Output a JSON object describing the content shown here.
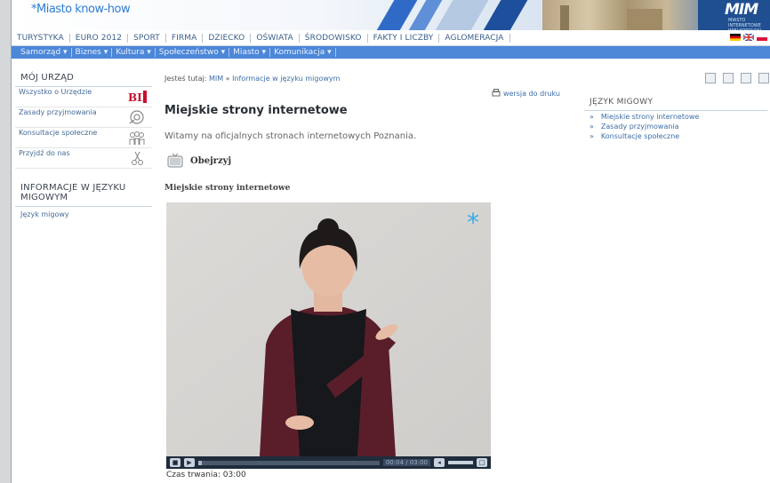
{
  "header": {
    "slogan": "*Miasto know-how",
    "logo_text": "MIM",
    "logo_subtext": "MIASTO INTERNETOWE WIELKOPOLSKI"
  },
  "top_menu": [
    "TURYSTYKA",
    "EURO 2012",
    "SPORT",
    "FIRMA",
    "DZIECKO",
    "OŚWIATA",
    "ŚRODOWISKO",
    "FAKTY I LICZBY",
    "AGLOMERACJA"
  ],
  "blue_menu": [
    "Samorząd ▾",
    "Biznes ▾",
    "Kultura ▾",
    "Społeczeństwo ▾",
    "Miasto ▾",
    "Komunikacja ▾"
  ],
  "left_column": {
    "section1_title": "MÓJ URZĄD",
    "items": [
      {
        "label": "Wszystko o Urzędzie",
        "icon": "bip-logo-icon"
      },
      {
        "label": "Zasady przyjmowania",
        "icon": "at-sign-icon"
      },
      {
        "label": "Konsultacje społeczne",
        "icon": "people-icon"
      },
      {
        "label": "Przyjdź do nas",
        "icon": "scissors-icon"
      }
    ],
    "section2_title": "INFORMACJE W JĘZYKU MIGOWYM",
    "link": "Język migowy"
  },
  "breadcrumb": {
    "prefix": "Jesteś tutaj:",
    "home": "MIM",
    "separator": "»",
    "current": "Informacje w języku migowym"
  },
  "print_label": "wersja do druku",
  "page_title": "Miejskie strony internetowe",
  "welcome": "Witamy na oficjalnych stronach internetowych Poznania.",
  "watch_label": "Obejrzyj",
  "video_subtitle": "Miejskie strony internetowe",
  "player": {
    "time": "00:04 / 03:00",
    "progress": 0.02
  },
  "duration": "Czas trwania: 03:00",
  "right_column": {
    "title": "JĘZYK MIGOWY",
    "items": [
      "Miejskie strony internetowe",
      "Zasady przyjmowania",
      "Konsultacje społeczne"
    ]
  },
  "colors": {
    "accent_blue": "#4c87d8",
    "link": "#3c6ea8",
    "asterisk": "#3aa9e8"
  }
}
